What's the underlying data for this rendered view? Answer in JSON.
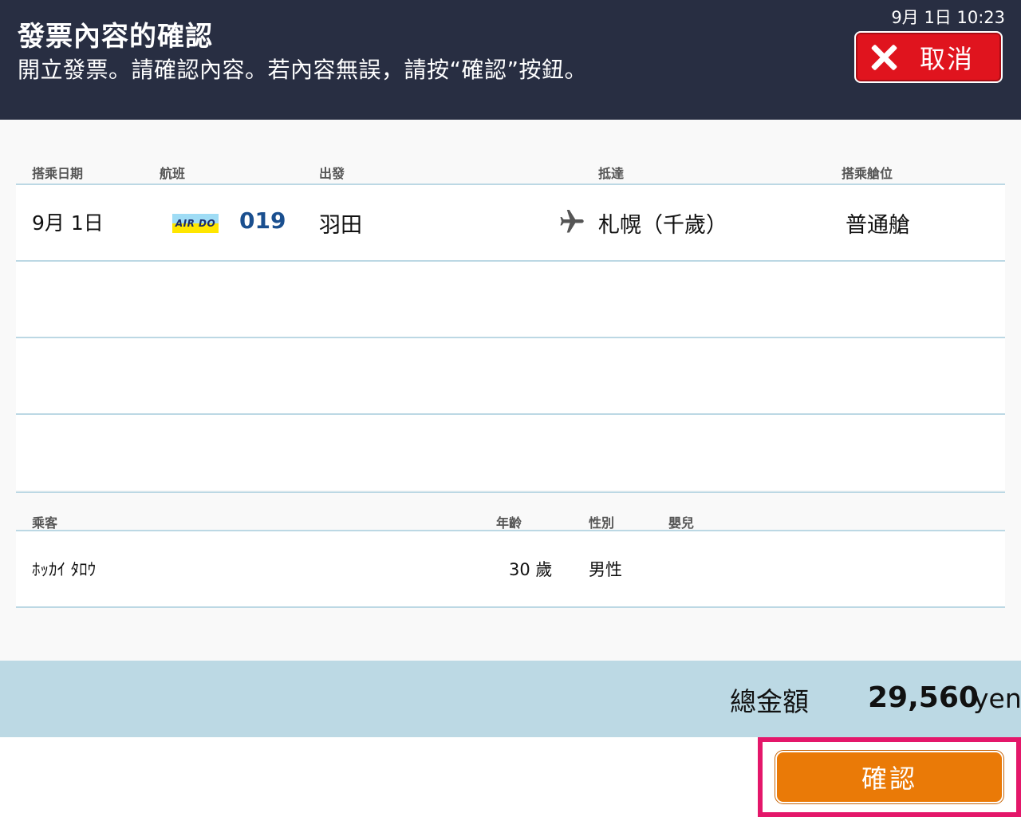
{
  "header": {
    "title": "發票內容的確認",
    "subtitle": "開立發票。請確認內容。若內容無誤，請按“確認”按鈕。",
    "clock": "9月 1日  10:23",
    "cancel_label": "取消"
  },
  "flight_table": {
    "columns": [
      "搭乘日期",
      "航班",
      "出發",
      "抵達",
      "搭乘艙位"
    ],
    "rows": [
      {
        "date": "9月 1日",
        "airline_logo_text": "AIR DO",
        "flight_number": "019",
        "departure": "羽田",
        "arrival": "札幌（千歲）",
        "class": "普通艙"
      }
    ]
  },
  "passenger_table": {
    "columns": [
      "乘客",
      "年齡",
      "性別",
      "嬰兒"
    ],
    "rows": [
      {
        "name": "ﾎｯｶｲ ﾀﾛｳ",
        "age": "30 歲",
        "gender": "男性",
        "infant": ""
      }
    ]
  },
  "total": {
    "label": "總金額",
    "amount": "29,560",
    "unit": "yen"
  },
  "confirm_label": "確認",
  "icons": {
    "cancel": "close-icon",
    "route": "airplane-icon"
  },
  "colors": {
    "header_bg": "#282e42",
    "cancel_red": "#e0141e",
    "confirm_orange": "#ea7a07",
    "highlight_pink": "#e4176a",
    "total_bar": "#bcd9e4",
    "flight_number_blue": "#1a4f8f"
  }
}
